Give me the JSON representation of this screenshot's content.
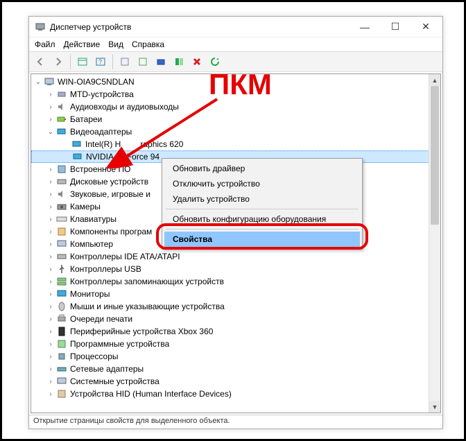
{
  "window": {
    "title": "Диспетчер устройств"
  },
  "menu": {
    "file": "Файл",
    "action": "Действие",
    "view": "Вид",
    "help": "Справка"
  },
  "tree": {
    "root": "WIN-OIA9C5NDLAN",
    "items": [
      "MTD-устройства",
      "Аудиовходы и аудиовыходы",
      "Батареи"
    ],
    "video_adapters": "Видеоадаптеры",
    "intel": "Intel(R) H",
    "intel_rest": "raphics 620",
    "nvidia": "NVIDIA GeForce 94",
    "rest": [
      "Встроенное ПО",
      "Дисковые устройств",
      "Звуковые, игровые и",
      "Камеры",
      "Клавиатуры",
      "Компоненты програм",
      "Компьютер",
      "Контроллеры IDE ATA/ATAPI",
      "Контроллеры USB",
      "Контроллеры запоминающих устройств",
      "Мониторы",
      "Мыши и иные указывающие устройства",
      "Очереди печати",
      "Периферийные устройства Xbox 360",
      "Программные устройства",
      "Процессоры",
      "Сетевые адаптеры",
      "Системные устройства",
      "Устройства HID (Human Interface Devices)"
    ]
  },
  "context": {
    "update": "Обновить драйвер",
    "disable": "Отключить устройство",
    "uninstall": "Удалить устройство",
    "scan": "Обновить конфигурацию оборудования",
    "props": "Свойства"
  },
  "status": "Открытие страницы свойств для выделенного объекта.",
  "annotation": "ПКМ"
}
